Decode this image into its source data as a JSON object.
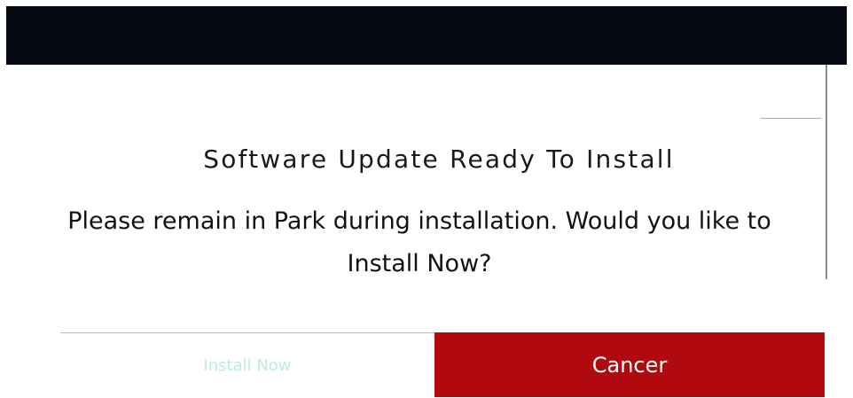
{
  "dialog": {
    "title": "Software Update Ready To Install",
    "message": "Please remain in Park during installation. Would you like to Install Now?"
  },
  "buttons": {
    "install_label": "Install Now",
    "cancel_label": "Cancer"
  },
  "colors": {
    "top_bar": "#050912",
    "cancel_background": "#b00a10",
    "install_text": "#b9ede4",
    "accent_rule": "#7fdcc0"
  }
}
